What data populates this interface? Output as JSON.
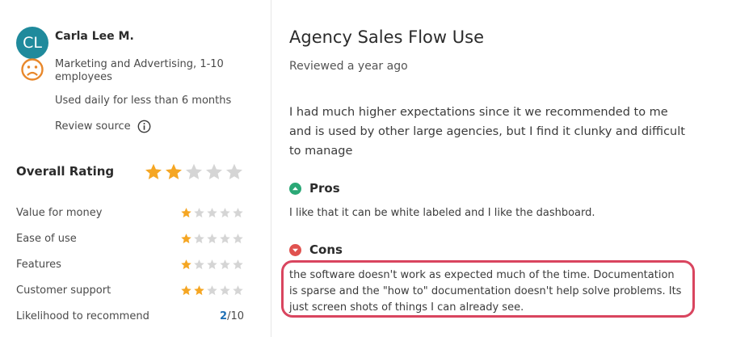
{
  "reviewer": {
    "initials": "CL",
    "name": "Carla Lee M.",
    "industry": "Marketing and Advertising, 1-10 employees",
    "usage": "Used daily for less than 6 months",
    "review_source_label": "Review source",
    "sentiment_icon": "sad-face-icon"
  },
  "ratings": {
    "overall_label": "Overall Rating",
    "overall_stars": 2,
    "items": [
      {
        "label": "Value for money",
        "stars": 1
      },
      {
        "label": "Ease of use",
        "stars": 1
      },
      {
        "label": "Features",
        "stars": 1
      },
      {
        "label": "Customer support",
        "stars": 2
      }
    ],
    "recommend": {
      "label": "Likelihood to recommend",
      "score": "2",
      "max": "/10"
    }
  },
  "review": {
    "title": "Agency Sales Flow Use",
    "reviewed": "Reviewed a year ago",
    "summary": "I had much higher expectations since it we recommended to me and is used by other large agencies, but I find it clunky and difficult to manage",
    "pros_label": "Pros",
    "pros": "I like that it can be white labeled and I like the dashboard.",
    "cons_label": "Cons",
    "cons": "the software doesn't work as expected much of the time. Documentation is sparse and the \"how to\" documentation doesn't help solve problems. Its just screen shots of things I can already see."
  },
  "colors": {
    "avatar": "#1f8a9c",
    "star_filled": "#f5a623",
    "star_empty": "#d5d5d5",
    "pros_icon": "#2aa876",
    "cons_icon": "#e0524f",
    "highlight_border": "#d9455f",
    "recommend_score": "#1f6fb4"
  }
}
